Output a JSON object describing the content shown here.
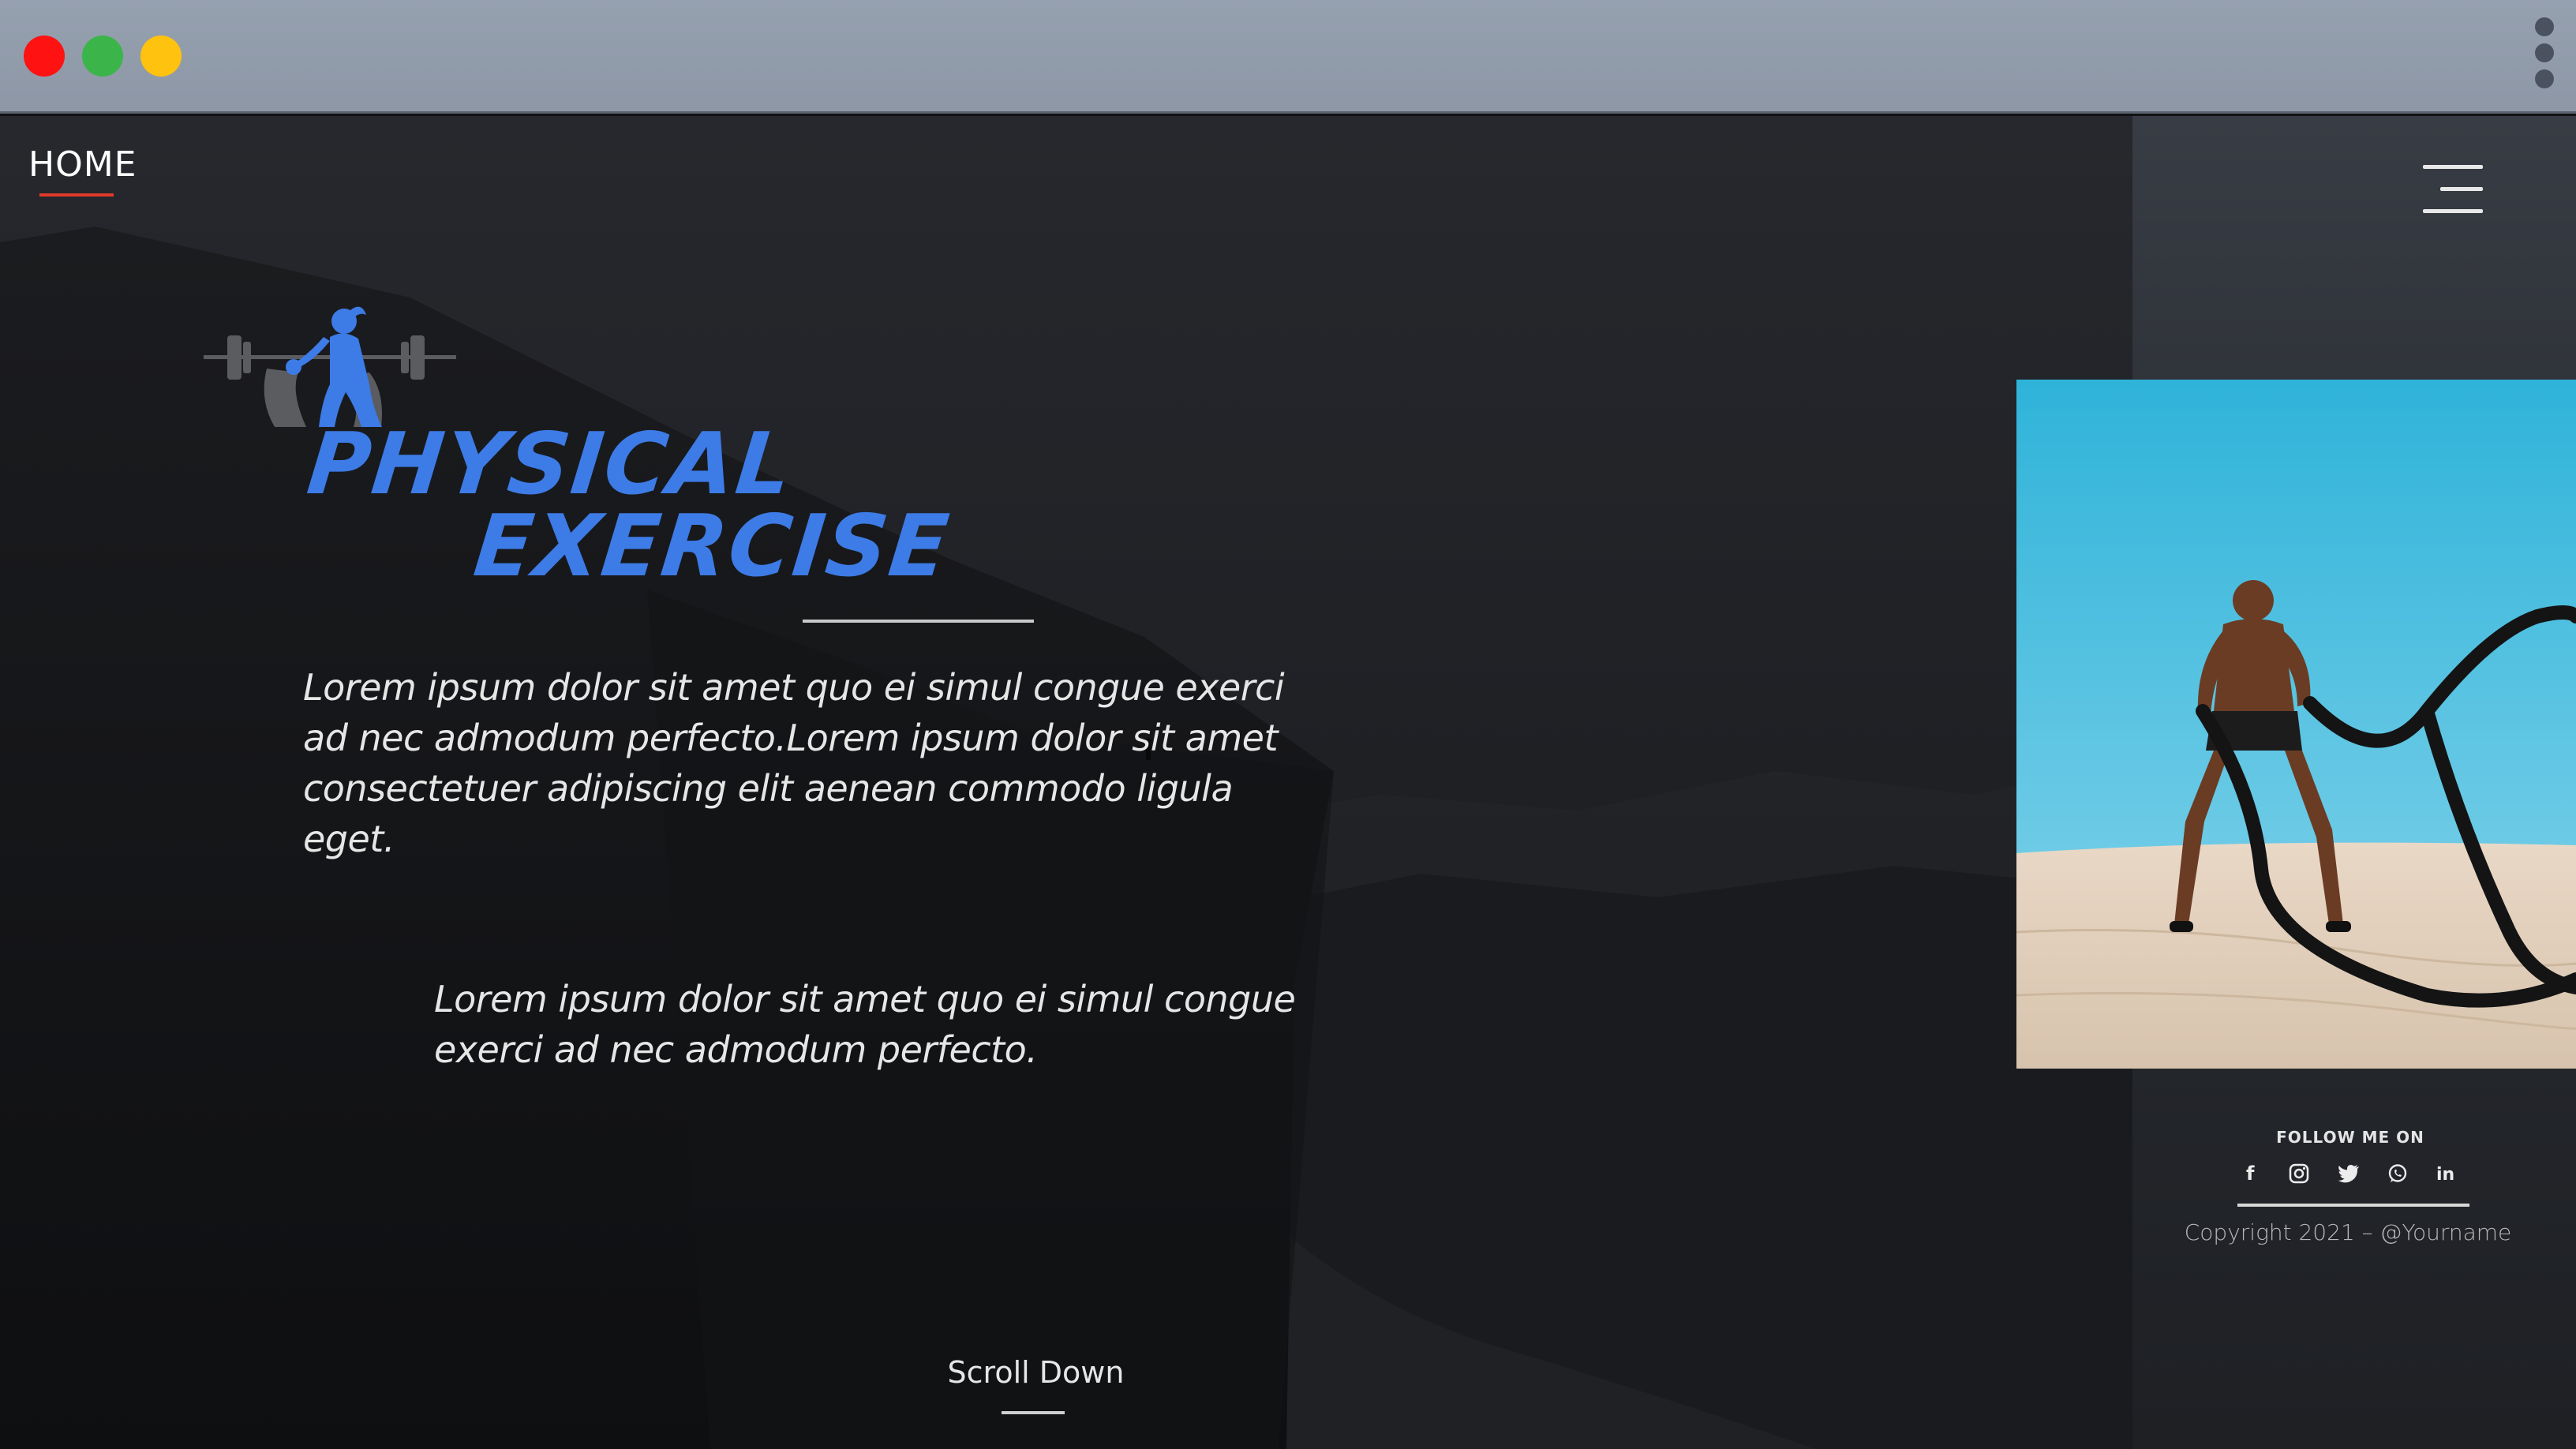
{
  "window": {
    "controls": [
      "close",
      "maximize",
      "minimize"
    ],
    "colors": {
      "close": "#ff1212",
      "maximize": "#3bb54a",
      "minimize": "#ffc20f"
    },
    "menu_icon": "kebab-menu-icon"
  },
  "nav": {
    "home_label": "HOME",
    "menu_icon": "hamburger-menu-icon",
    "accent": "#e23a2a"
  },
  "hero": {
    "logo_icon": "fitness-woman-barbell-icon",
    "title_line1": "PHYSICAL",
    "title_line2": "EXERCISE",
    "title_color": "#3d7be6",
    "paragraph1": "Lorem ipsum dolor sit amet quo ei simul congue exerci ad nec admodum perfecto.Lorem ipsum dolor sit amet consectetuer adipiscing elit aenean commodo ligula eget.",
    "paragraph2": "Lorem ipsum dolor sit amet quo ei simul congue exerci ad nec admodum perfecto.",
    "scroll_label": "Scroll Down"
  },
  "photo": {
    "subject_icon": "battle-ropes-athlete-photo"
  },
  "sidebar": {
    "follow_label": "FOLLOW ME ON",
    "social": [
      {
        "name": "facebook-icon",
        "glyph": "f"
      },
      {
        "name": "instagram-icon",
        "glyph": ""
      },
      {
        "name": "twitter-icon",
        "glyph": ""
      },
      {
        "name": "whatsapp-icon",
        "glyph": ""
      },
      {
        "name": "linkedin-icon",
        "glyph": "in"
      }
    ],
    "copyright": "Copyright 2021 – @Yourname"
  }
}
